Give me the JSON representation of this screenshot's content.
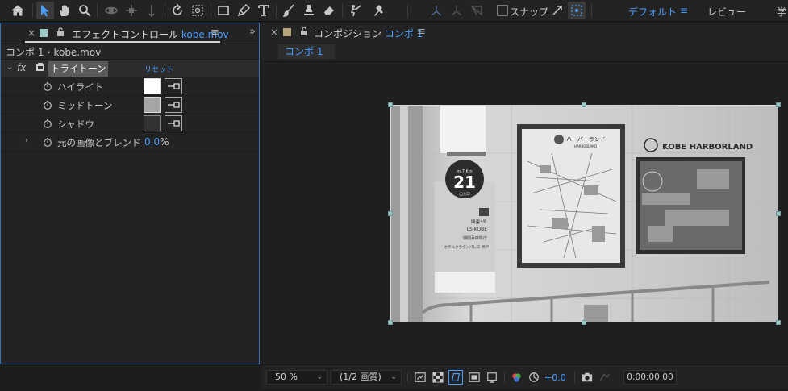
{
  "toolbar": {
    "snap_label": "スナップ",
    "workspace_default": "デフォルト",
    "workspace_review": "レビュー",
    "workspace_cut": "学"
  },
  "effect_panel": {
    "tab_prefix": "エフェクトコントロール",
    "tab_file": "kobe.mov",
    "comp_path": "コンポ 1・kobe.mov",
    "fx_label": "fx",
    "effect_name": "トライトーン",
    "reset_label": "リセット",
    "properties": [
      {
        "label": "ハイライト",
        "color": "#ffffff"
      },
      {
        "label": "ミッドトーン",
        "color": "#a6a6a6"
      },
      {
        "label": "シャドウ",
        "color": "#323232"
      }
    ],
    "blend_label": "元の画像とブレンド",
    "blend_value": "0.0",
    "blend_unit": "%"
  },
  "composition_panel": {
    "tab_prefix": "コンポジション",
    "tab_name": "コンポ 1",
    "subtab": "コンポ 1"
  },
  "photo": {
    "sign_number": "21",
    "sign_top": "m.7.Km",
    "sign_bottom": "出入口",
    "sign_text1": "関連3号",
    "sign_text2": "LS KOBE",
    "sign_text3": "期間兵庫県庁",
    "sign_text4": "ホテルクラウンパレス 神戸",
    "map1_title": "ハーバーランド",
    "map1_sub": "HARBORLAND",
    "map2_title": "KOBE HARBORLAND"
  },
  "bottom_bar": {
    "zoom": "50 %",
    "resolution": "(1/2 画質)",
    "exposure": "+0.0",
    "timecode": "0:00:00:00"
  },
  "colors": {
    "accent": "#4a9eff",
    "panel_border": "#3b6fb0",
    "handle": "#9dc8c8"
  }
}
